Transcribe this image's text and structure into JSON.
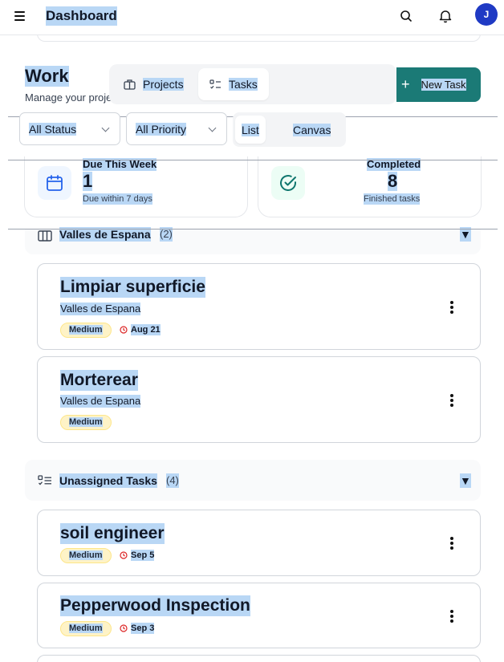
{
  "topbar": {
    "title": "Dashboard",
    "avatar_initial": "J"
  },
  "header": {
    "title": "Work",
    "subtitle": "Manage your proje"
  },
  "switcher": {
    "tabs": [
      {
        "label": "Projects",
        "icon": "briefcase-icon",
        "active": false
      },
      {
        "label": "Tasks",
        "icon": "task-list-icon",
        "active": true
      }
    ]
  },
  "new_task_button": {
    "label": "New Task",
    "icon": "plus-icon"
  },
  "filters": {
    "status": "All Status",
    "priority": "All Priority"
  },
  "view_toggle": {
    "list": "List",
    "canvas": "Canvas",
    "selected": "List"
  },
  "stats": [
    {
      "label": "Due This Week",
      "value": "1",
      "note": "Due within 7 days",
      "icon": "calendar-icon",
      "accent": "#2563eb"
    },
    {
      "label": "Completed",
      "value": "8",
      "note": "Finished tasks",
      "icon": "check-circle-icon",
      "accent": "#0f766e"
    }
  ],
  "groups": [
    {
      "name": "Valles de Espana",
      "count": "(2)",
      "caret": "▼",
      "icon": "columns-icon",
      "tasks": [
        {
          "title": "Limpiar superficie",
          "project": "Valles de Espana",
          "priority": "Medium",
          "due": "Aug 21"
        },
        {
          "title": "Morterear",
          "project": "Valles de Espana",
          "priority": "Medium",
          "due": ""
        }
      ]
    },
    {
      "name": "Unassigned Tasks",
      "count": "(4)",
      "caret": "▼",
      "icon": "task-list-icon",
      "tasks": [
        {
          "title": "soil engineer",
          "priority": "Medium",
          "due": "Sep 5"
        },
        {
          "title": "Pepperwood Inspection",
          "priority": "Medium",
          "due": "Sep 3"
        }
      ]
    }
  ],
  "colors": {
    "primary": "#1b7a76",
    "avatar": "#1f3ac4",
    "priority_medium_bg": "#fef3c7",
    "due_icon": "#dc2626",
    "selection": "#b9d7f5"
  }
}
